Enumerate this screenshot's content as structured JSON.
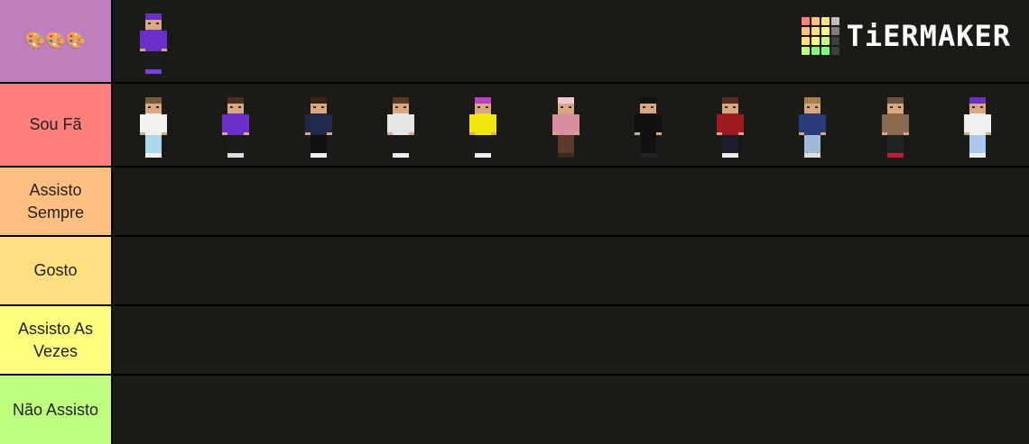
{
  "brand": {
    "name": "TiERMAKER",
    "grid_colors": [
      "#ff7f7f",
      "#ffbf7f",
      "#ffdf7f",
      "#bfbfbf",
      "#ffbf7f",
      "#ffdf7f",
      "#ffff7f",
      "#7f7f7f",
      "#ffdf7f",
      "#ffff7f",
      "#bfff7f",
      "#3f3f3f",
      "#bfff7f",
      "#7fff7f",
      "#7fff7f",
      "#3f3f3f"
    ]
  },
  "tiers": [
    {
      "label": "🎨🎨🎨",
      "color": "#bf7fbf",
      "items": [
        {
          "name": "purple-hoodie-skin",
          "hair": "#6a2fc9",
          "shirt": "#6a2fc9",
          "pants": "#1c1c1c",
          "shoes": "#7a3fe0"
        }
      ]
    },
    {
      "label": "Sou Fã",
      "color": "#ff7f7f",
      "items": [
        {
          "name": "white-shirt-skin",
          "hair": "#7a5a3c",
          "shirt": "#f2f2f2",
          "pants": "#a9d8ea",
          "shoes": "#f2f2f2"
        },
        {
          "name": "purple-shirt-skin",
          "hair": "#4b2e20",
          "shirt": "#6a2fc9",
          "pants": "#1c1c1c",
          "shoes": "#ddd"
        },
        {
          "name": "navy-hoodie-skin",
          "hair": "#3a2418",
          "shirt": "#1f2a4a",
          "pants": "#111",
          "shoes": "#eee"
        },
        {
          "name": "white-hoodie-skin",
          "hair": "#5a3a24",
          "shirt": "#e6e6e6",
          "pants": "#1a1a1a",
          "shoes": "#eee"
        },
        {
          "name": "yellow-hoodie-skin",
          "hair": "#c03fc9",
          "shirt": "#f1e70d",
          "pants": "#1c1c1c",
          "shoes": "#eee"
        },
        {
          "name": "pink-skin",
          "hair": "#f3c6cf",
          "shirt": "#d88fa0",
          "pants": "#5a3a2a",
          "shoes": "#3a2a20"
        },
        {
          "name": "black-suit-skin",
          "hair": "#111",
          "shirt": "#111",
          "pants": "#111",
          "shoes": "#222"
        },
        {
          "name": "red-hoodie-skin",
          "hair": "#5a2a22",
          "shirt": "#a01a22",
          "pants": "#1c1c2a",
          "shoes": "#eee"
        },
        {
          "name": "blue-jacket-skin",
          "hair": "#a8804a",
          "shirt": "#2a3a7a",
          "pants": "#9fb8d8",
          "shoes": "#ddd"
        },
        {
          "name": "brown-coat-skin",
          "hair": "#6a5040",
          "shirt": "#8a6a50",
          "pants": "#222",
          "shoes": "#c01a3a"
        },
        {
          "name": "white-purple-skin",
          "hair": "#6a2fc9",
          "shirt": "#f0f0f0",
          "pants": "#a9c8ea",
          "shoes": "#eee"
        }
      ]
    },
    {
      "label": "Assisto Sempre",
      "color": "#ffbf7f",
      "items": []
    },
    {
      "label": "Gosto",
      "color": "#ffdf7f",
      "items": []
    },
    {
      "label": "Assisto As Vezes",
      "color": "#ffff7f",
      "items": []
    },
    {
      "label": "Não Assisto",
      "color": "#bfff7f",
      "items": []
    }
  ]
}
